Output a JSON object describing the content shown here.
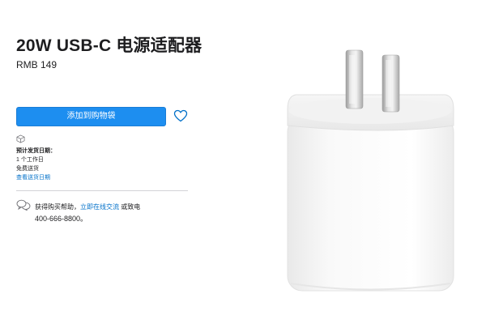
{
  "product": {
    "title": "20W USB-C 电源适配器",
    "price": "RMB 149"
  },
  "actions": {
    "add_to_bag": "添加到购物袋"
  },
  "shipping": {
    "heading": "预计发货日期：",
    "days": "1 个工作日",
    "free": "免费送货",
    "check_date": "查看送货日期"
  },
  "help": {
    "prefix": "获得购买帮助，",
    "chat_link": "立即在线交流",
    "or_call": " 或致电",
    "phone": "400-666-8800。"
  },
  "icons": {
    "favorite": "heart-icon",
    "shipping": "box-icon",
    "chat": "chat-bubbles-icon"
  },
  "colors": {
    "accent": "#1d8ef0",
    "link": "#0070c9"
  }
}
